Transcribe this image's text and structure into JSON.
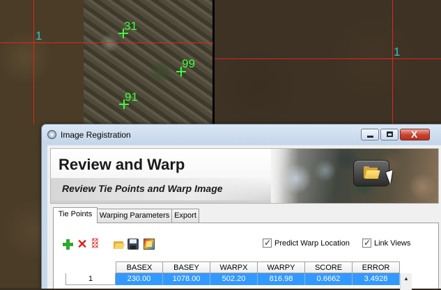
{
  "background": {
    "left_label": "1",
    "right_label": "1",
    "gcps": [
      {
        "label": "31",
        "color": "#3cff3c"
      },
      {
        "label": "99",
        "color": "#3cff3c"
      },
      {
        "label": "91",
        "color": "#3cff3c"
      }
    ],
    "line_color": "#e0261f",
    "label_color": "#2ec8c8"
  },
  "window": {
    "title": "Image Registration",
    "buttons": {
      "minimize": "minimize",
      "maximize": "maximize",
      "close": "X"
    }
  },
  "banner": {
    "title": "Review and Warp",
    "subtitle": "Review Tie Points and Warp Image",
    "icon": "folder-icon"
  },
  "tabs": [
    {
      "label": "Tie Points",
      "active": true
    },
    {
      "label": "Warping Parameters",
      "active": false
    },
    {
      "label": "Export",
      "active": false
    }
  ],
  "toolbar": {
    "icons": [
      "add-icon",
      "delete-icon",
      "delete-all-icon",
      "open-icon",
      "save-icon",
      "warp-icon"
    ]
  },
  "options": {
    "predict_warp_label": "Predict Warp Location",
    "predict_warp_checked": true,
    "link_views_label": "Link Views",
    "link_views_checked": true
  },
  "table": {
    "columns": [
      "BASEX",
      "BASEY",
      "WARPX",
      "WARPY",
      "SCORE",
      "ERROR"
    ],
    "rows": [
      {
        "id": "1",
        "cells": [
          "230.00",
          "1078.00",
          "502.20",
          "816.98",
          "0.6662",
          "3.4928"
        ]
      }
    ],
    "selection_color": "#3399ff"
  }
}
